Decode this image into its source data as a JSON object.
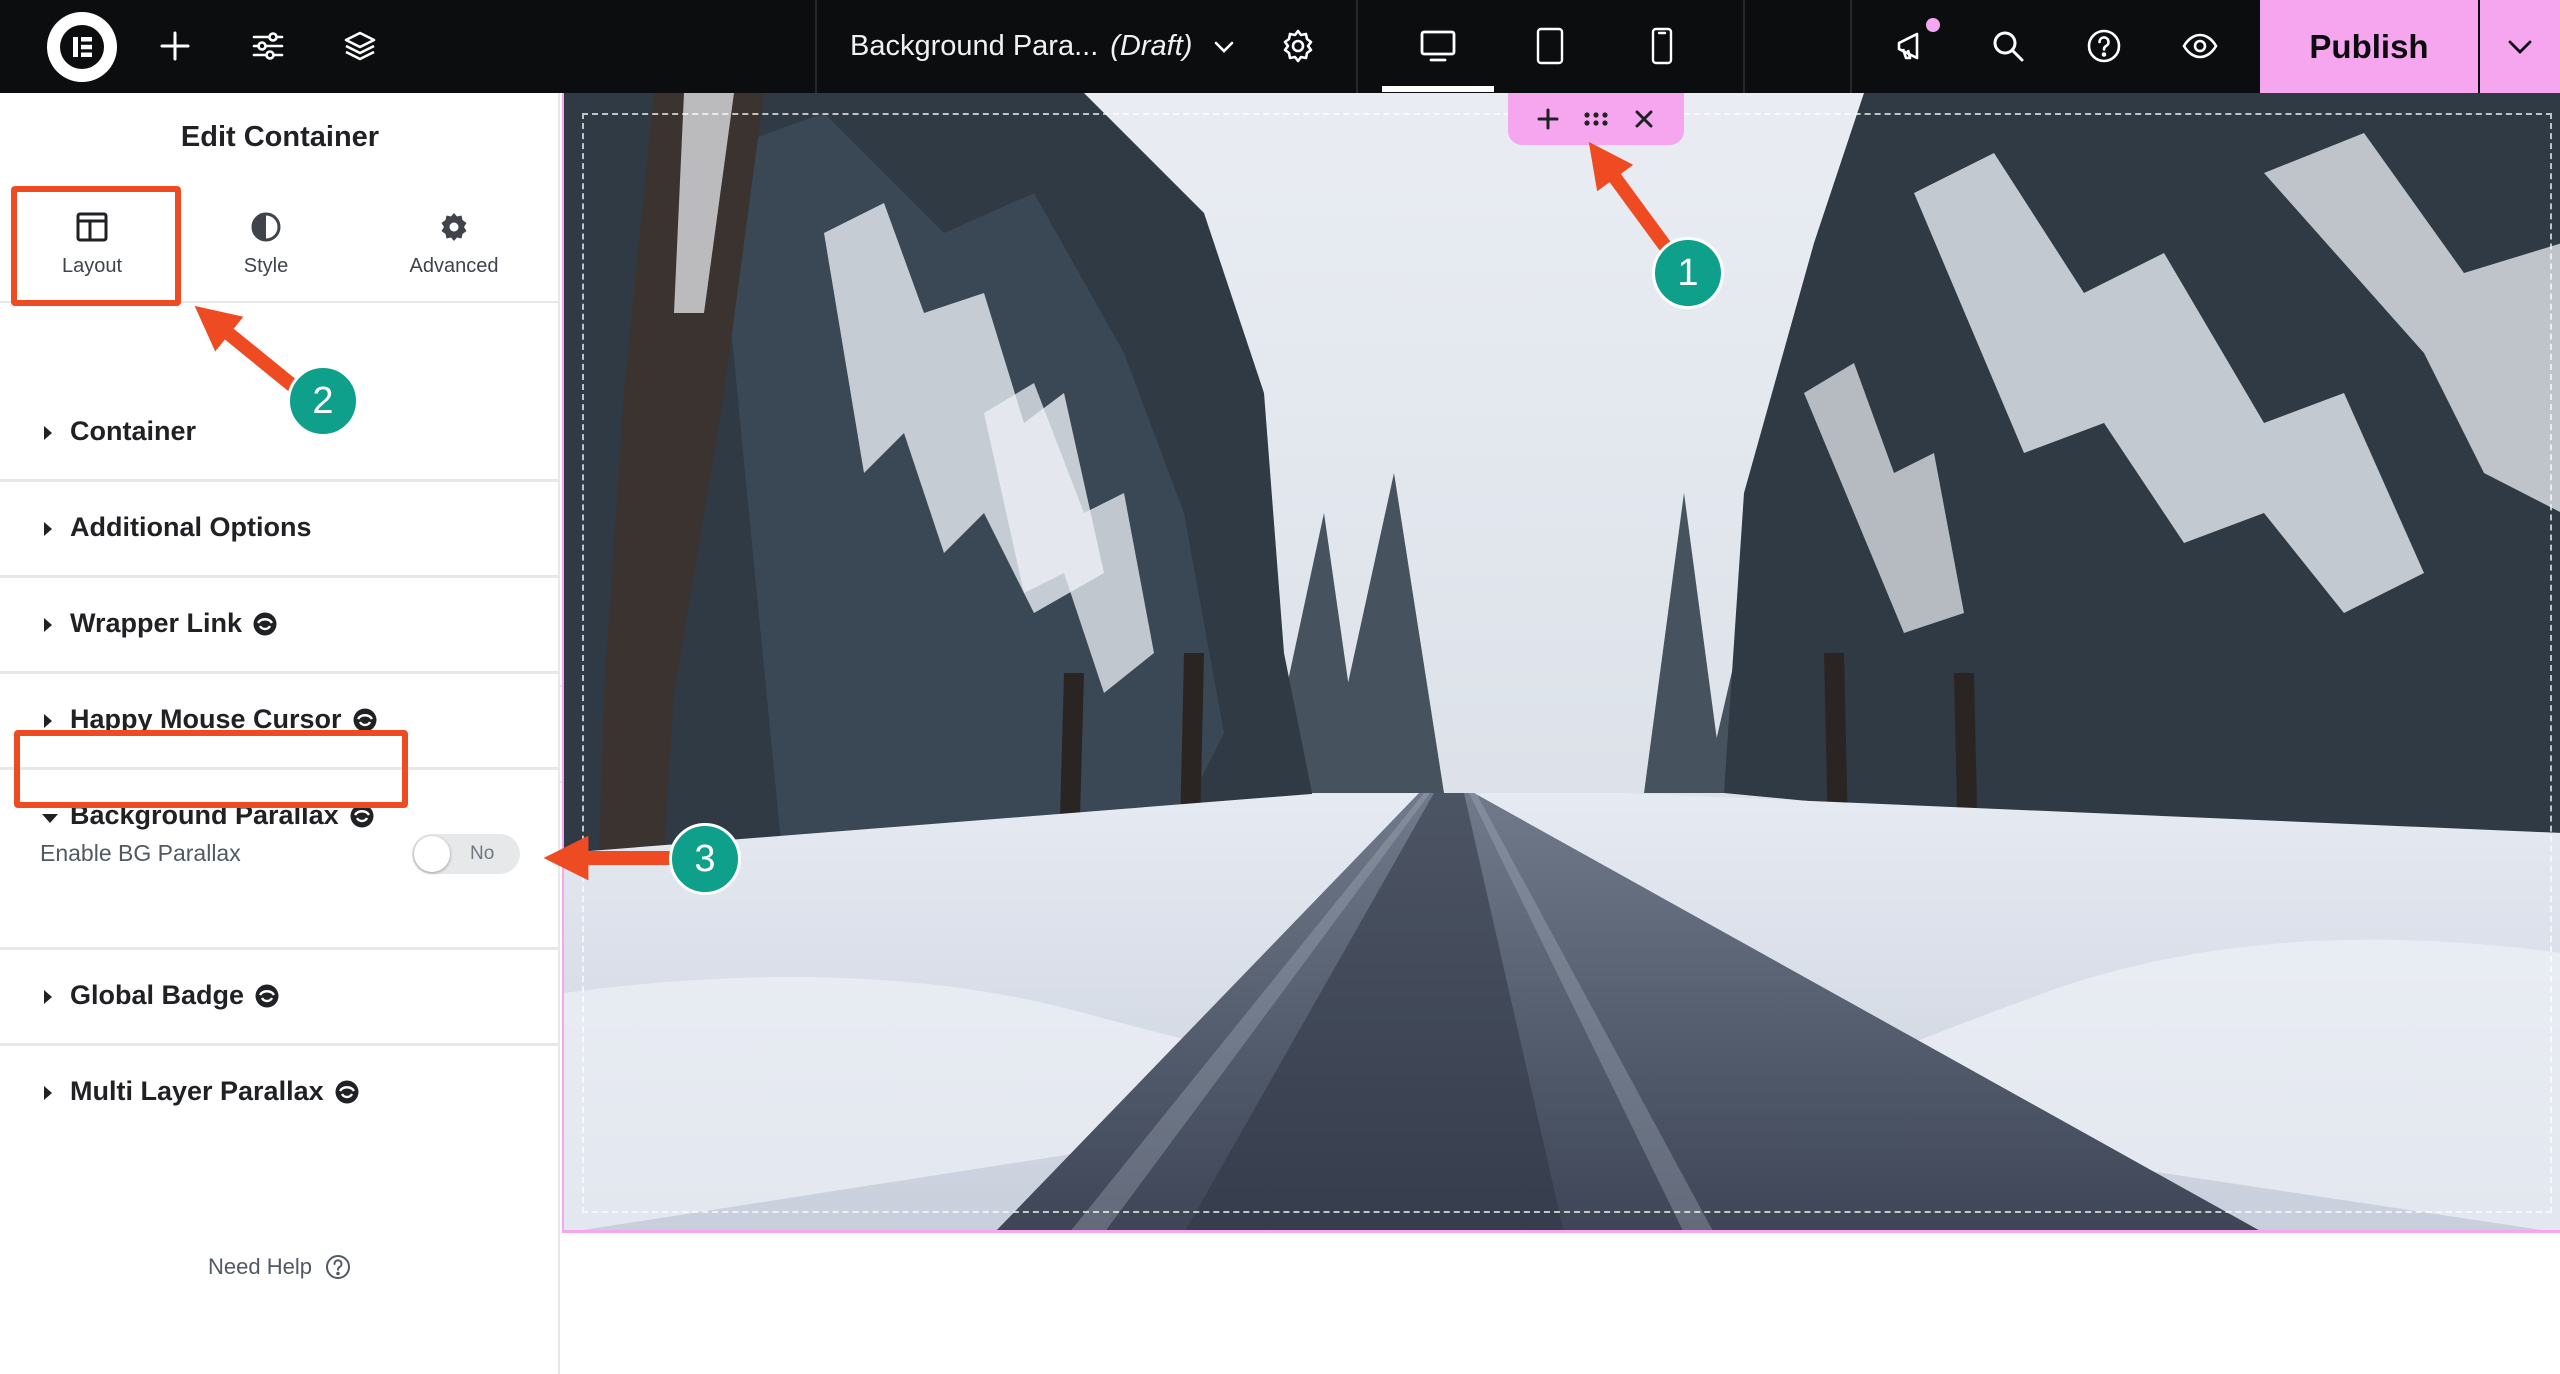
{
  "topbar": {
    "document_title": "Background Para...",
    "document_status": "(Draft)",
    "publish_label": "Publish",
    "icons": [
      "elementor-logo-icon",
      "plus-icon",
      "sliders-icon",
      "layers-icon",
      "chevron-down-icon",
      "gear-icon",
      "desktop-icon",
      "tablet-icon",
      "mobile-icon",
      "megaphone-icon",
      "search-icon",
      "help-icon",
      "eye-icon",
      "chevron-down-icon"
    ],
    "colors": {
      "background": "#0c0d0e",
      "publish": "#f5a6ef",
      "notification_dot": "#f4a8f2"
    }
  },
  "panel": {
    "title": "Edit Container",
    "tabs": [
      {
        "label": "Layout",
        "icon": "columns-icon",
        "active": true
      },
      {
        "label": "Style",
        "icon": "half-circle-icon",
        "active": false
      },
      {
        "label": "Advanced",
        "icon": "gear-icon",
        "active": false
      }
    ],
    "sections": [
      {
        "title": "Container",
        "expanded": false,
        "pro_icon": false
      },
      {
        "title": "Additional Options",
        "expanded": false,
        "pro_icon": false
      },
      {
        "title": "Wrapper Link",
        "expanded": false,
        "pro_icon": true
      },
      {
        "title": "Happy Mouse Cursor",
        "expanded": false,
        "pro_icon": true
      },
      {
        "title": "Background Parallax",
        "expanded": true,
        "pro_icon": true
      },
      {
        "title": "Global Badge",
        "expanded": false,
        "pro_icon": true
      },
      {
        "title": "Multi Layer Parallax",
        "expanded": false,
        "pro_icon": true
      }
    ],
    "parallax_control": {
      "label": "Enable BG Parallax",
      "toggle_text": "No",
      "enabled": false
    },
    "need_help": "Need Help"
  },
  "canvas": {
    "container_toolbar": [
      "plus-icon",
      "drag-dots-icon",
      "close-icon"
    ],
    "background": "snowy tree-lined road photo"
  },
  "annotations": {
    "steps": [
      "1",
      "2",
      "3"
    ],
    "colors": {
      "box": "#ef4b23",
      "badge": "#0fa08c"
    }
  }
}
